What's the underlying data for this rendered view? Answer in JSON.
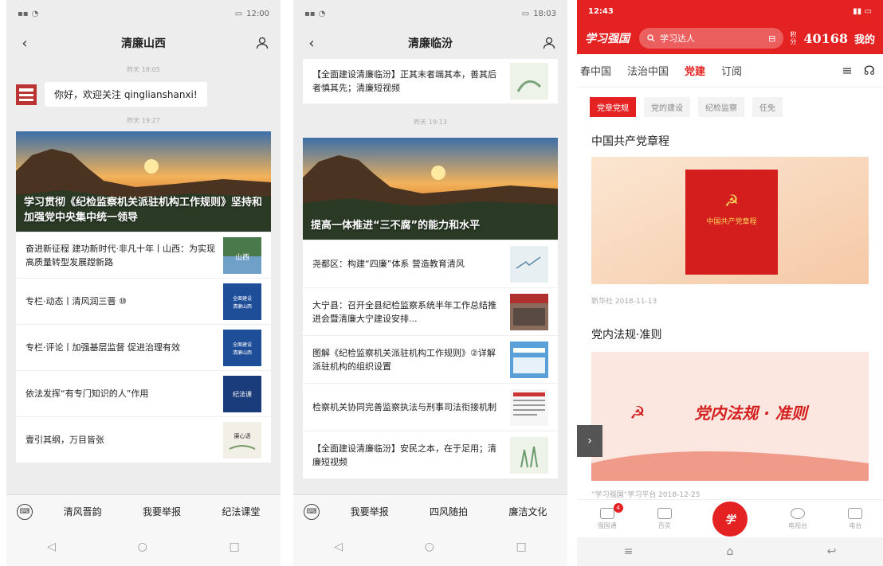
{
  "p1": {
    "status": {
      "time": "12:00"
    },
    "title": "清廉山西",
    "ts1": "昨天 18:05",
    "greeting": "你好，欢迎关注 qinglianshanxi!",
    "ts2": "昨天 19:27",
    "hero": "学习贯彻《纪检监察机关派驻机构工作规则》坚持和加强党中央集中统一领导",
    "items": [
      {
        "text": "奋进新征程 建功新时代·非凡十年丨山西：为实现高质量转型发展蹚新路",
        "thumb": "山西"
      },
      {
        "text": "专栏·动态丨清风润三晋 ⑩",
        "thumb": "全面建设清廉山西"
      },
      {
        "text": "专栏·评论丨加强基层监督 促进治理有效",
        "thumb": "全面建设清廉山西"
      },
      {
        "text": "依法发挥“有专门知识的人”作用",
        "thumb": "纪法课"
      },
      {
        "text": "壹引其纲，万目皆张",
        "thumb": "廉心语"
      }
    ],
    "bottom": [
      "清风晋韵",
      "我要举报",
      "纪法课堂"
    ]
  },
  "p2": {
    "status": {
      "time": "18:03"
    },
    "title": "清廉临汾",
    "top": "【全面建设清廉临汾】正其末者端其本，善其后者慎其先；清廉短视频",
    "ts": "昨天 19:13",
    "hero": "提高一体推进“三不腐”的能力和水平",
    "items": [
      {
        "text": "尧都区：构建“四廉”体系 营造教育清风"
      },
      {
        "text": "大宁县：召开全县纪检监察系统半年工作总结推进会暨清廉大宁建设安排..."
      },
      {
        "text": "图解《纪检监察机关派驻机构工作规则》②详解派驻机构的组织设置"
      },
      {
        "text": "检察机关协同完善监察执法与刑事司法衔接机制"
      },
      {
        "text": "【全面建设清廉临汾】安民之本，在于足用；清廉短视频"
      }
    ],
    "bottom": [
      "我要举报",
      "四风随拍",
      "廉洁文化"
    ]
  },
  "p3": {
    "status": {
      "time": "12:43"
    },
    "logo": "学习强国",
    "search": "学习达人",
    "points_prefix": "积分",
    "points": "40168",
    "mine": "我的",
    "tabs": [
      "春中国",
      "法治中国",
      "党建",
      "订阅"
    ],
    "chips": [
      "党章党规",
      "党的建设",
      "纪检监察",
      "任免"
    ],
    "sec1": "中国共产党章程",
    "book": "中国共产党章程",
    "meta1": "新华社 2018-11-13",
    "sec2": "党内法规·准则",
    "banner": "党内法规 · 准则",
    "meta2": "“学习强国”学习平台 2018-12-25",
    "tabbar": [
      "强国通",
      "百灵",
      "",
      "电视台",
      "电台"
    ],
    "badge": "4",
    "center": "学"
  }
}
